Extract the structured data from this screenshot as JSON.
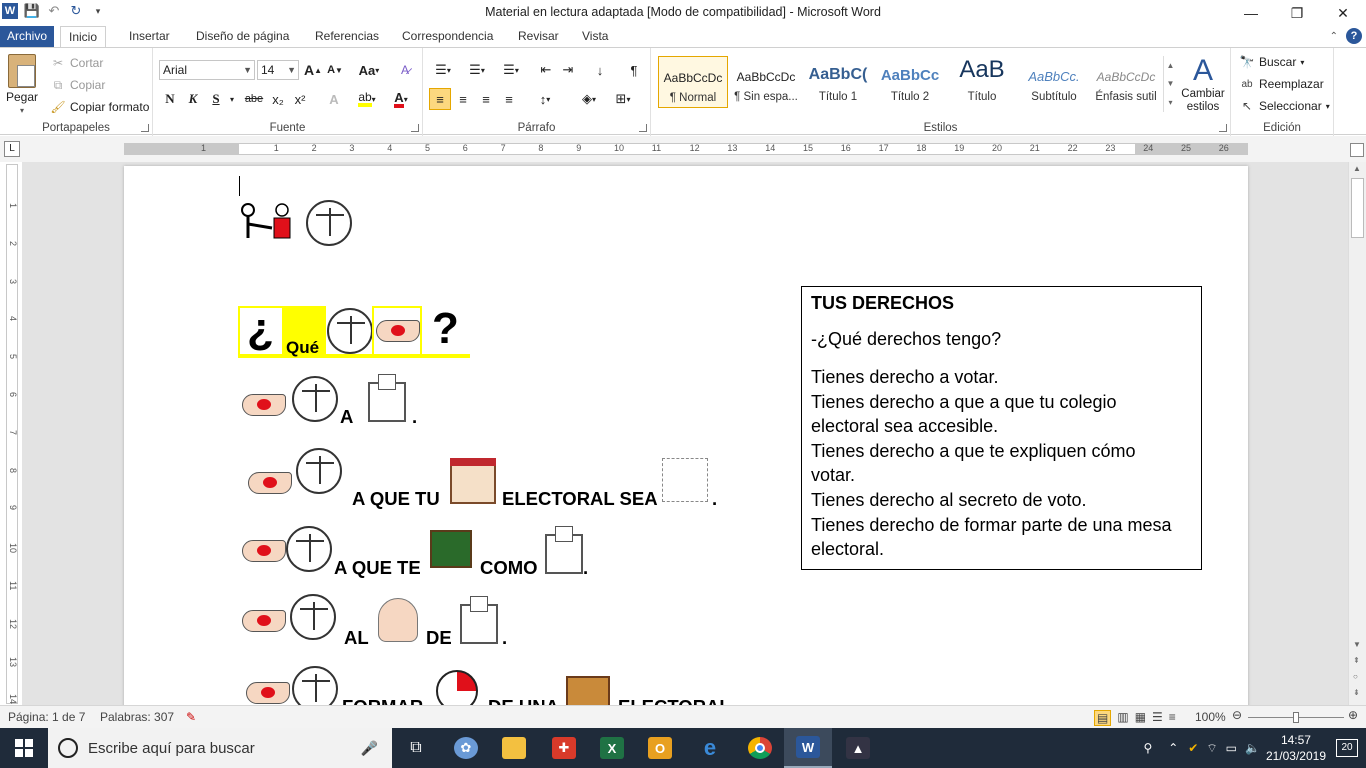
{
  "window": {
    "title": "Material en lectura adaptada [Modo de compatibilidad]  -  Microsoft Word",
    "minimize": "—",
    "restore": "❐",
    "close": "✕"
  },
  "tabs": [
    "Archivo",
    "Inicio",
    "Insertar",
    "Diseño de página",
    "Referencias",
    "Correspondencia",
    "Revisar",
    "Vista"
  ],
  "ribbon": {
    "clipboard": {
      "paste": "Pegar",
      "cut": "Cortar",
      "copy": "Copiar",
      "format_painter": "Copiar formato",
      "label": "Portapapeles"
    },
    "font": {
      "family": "Arial",
      "size": "14",
      "label": "Fuente",
      "bold": "N",
      "italic": "K",
      "underline": "S",
      "strike": "abe",
      "subscript": "x₂",
      "superscript": "x²",
      "grow": "A",
      "shrink": "A",
      "case": "Aa",
      "font_color_accent": "#e0101a",
      "highlight_accent": "#ffff00"
    },
    "paragraph": {
      "label": "Párrafo"
    },
    "styles": {
      "label": "Estilos",
      "items": [
        {
          "sample": "AaBbCcDc",
          "name": "¶ Normal"
        },
        {
          "sample": "AaBbCcDc",
          "name": "¶ Sin espa..."
        },
        {
          "sample": "AaBbC(",
          "name": "Título 1"
        },
        {
          "sample": "AaBbCc",
          "name": "Título 2"
        },
        {
          "sample": "AaB",
          "name": "Título"
        },
        {
          "sample": "AaBbCc.",
          "name": "Subtítulo"
        },
        {
          "sample": "AaBbCcDc",
          "name": "Énfasis sutil"
        }
      ],
      "change": "Cambiar estilos"
    },
    "editing": {
      "label": "Edición",
      "find": "Buscar",
      "replace": "Reemplazar",
      "select": "Seleccionar"
    }
  },
  "ruler": {
    "numbers": [
      "1",
      "1",
      "2",
      "3",
      "4",
      "5",
      "6",
      "7",
      "8",
      "9",
      "10",
      "11",
      "12",
      "13",
      "14",
      "15",
      "16",
      "17",
      "18",
      "19",
      "20",
      "21",
      "22",
      "23",
      "24",
      "25",
      "26"
    ],
    "vnumbers": [
      "1",
      "2",
      "3",
      "4",
      "5",
      "6",
      "7",
      "8",
      "9",
      "10",
      "11",
      "12",
      "13",
      "14"
    ]
  },
  "document": {
    "question_word": "Qué",
    "line1": [
      "A",
      "."
    ],
    "line2": [
      "A QUE TU",
      "ELECTORAL SEA",
      "."
    ],
    "line3": [
      "A QUE TE",
      "COMO",
      "."
    ],
    "line4": [
      "AL",
      "DE",
      "."
    ],
    "line5": [
      "FORMAR",
      "DE UNA",
      "ELECTORAL"
    ],
    "textbox": {
      "title": "TUS DERECHOS",
      "question": "-¿Qué derechos tengo?",
      "lines": [
        "Tienes derecho a votar.",
        "Tienes derecho a que a que tu colegio",
        "electoral sea accesible.",
        "Tienes derecho a que te expliquen cómo",
        "votar.",
        "Tienes derecho al secreto de voto.",
        "Tienes derecho de formar parte de una mesa",
        "electoral."
      ]
    }
  },
  "statusbar": {
    "page": "Página: 1 de 7",
    "words": "Palabras: 307",
    "zoom": "100%"
  },
  "taskbar": {
    "search_placeholder": "Escribe aquí para buscar",
    "time": "14:57",
    "date": "21/03/2019",
    "notifications": "20"
  }
}
